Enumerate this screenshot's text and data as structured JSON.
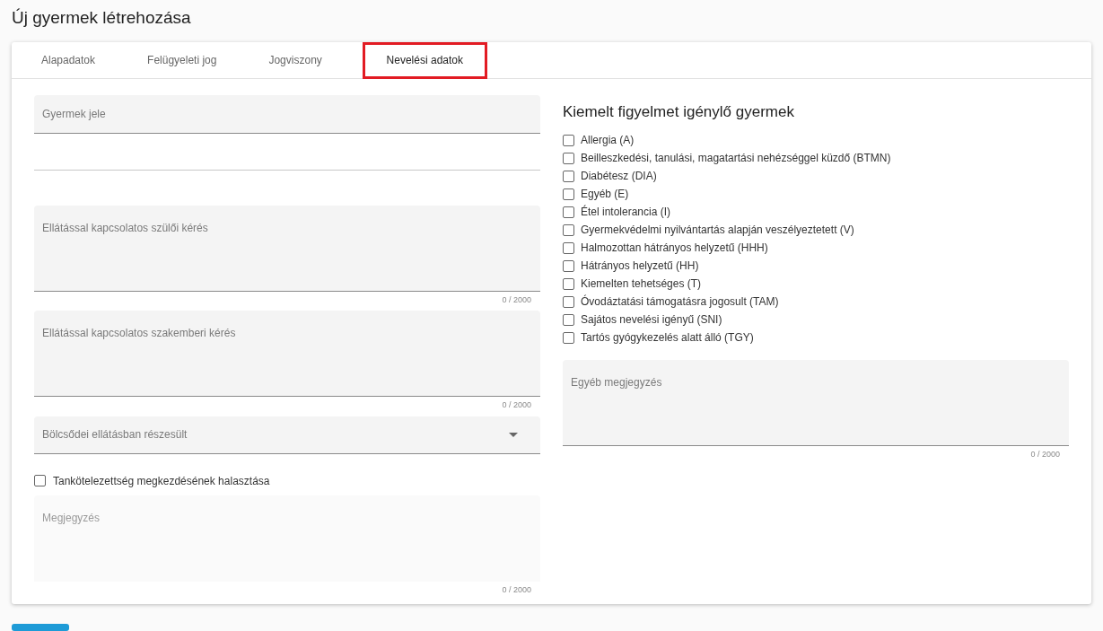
{
  "page": {
    "title": "Új gyermek létrehozása"
  },
  "tabs": [
    {
      "label": "Alapadatok",
      "selected": false
    },
    {
      "label": "Felügyeleti jog",
      "selected": false
    },
    {
      "label": "Jogviszony",
      "selected": false
    },
    {
      "label": "Nevelési adatok",
      "selected": true
    }
  ],
  "left_fields": [
    {
      "kind": "text",
      "label": "Gyermek jele"
    },
    {
      "kind": "line"
    },
    {
      "kind": "textarea",
      "label": "Ellátással kapcsolatos szülői kérés",
      "counter": "0 / 2000",
      "disabled": false
    },
    {
      "kind": "textarea",
      "label": "Ellátással kapcsolatos szakemberi kérés",
      "counter": "0 / 2000",
      "disabled": false
    },
    {
      "kind": "select",
      "label": "Bölcsődei ellátásban részesült"
    },
    {
      "kind": "checkbox",
      "label": "Tankötelezettség megkezdésének halasztása",
      "checked": false
    },
    {
      "kind": "textarea",
      "label": "Megjegyzés",
      "counter": "0 / 2000",
      "disabled": true
    }
  ],
  "special_needs": {
    "title": "Kiemelt figyelmet igénylő gyermek",
    "options": [
      {
        "label": "Allergia (A)",
        "checked": false
      },
      {
        "label": "Beilleszkedési, tanulási, magatartási nehézséggel küzdő (BTMN)",
        "checked": false
      },
      {
        "label": "Diabétesz (DIA)",
        "checked": false
      },
      {
        "label": "Egyéb (E)",
        "checked": false
      },
      {
        "label": "Étel intolerancia (I)",
        "checked": false
      },
      {
        "label": "Gyermekvédelmi nyilvántartás alapján veszélyeztetett (V)",
        "checked": false
      },
      {
        "label": "Halmozottan hátrányos helyzetű (HHH)",
        "checked": false
      },
      {
        "label": "Hátrányos helyzetű (HH)",
        "checked": false
      },
      {
        "label": "Kiemelten tehetséges (T)",
        "checked": false
      },
      {
        "label": "Óvodáztatási támogatásra jogosult (TAM)",
        "checked": false
      },
      {
        "label": "Sajátos nevelési igényű (SNI)",
        "checked": false
      },
      {
        "label": "Tartós gyógykezelés alatt álló (TGY)",
        "checked": false
      }
    ],
    "note": {
      "label": "Egyéb megjegyzés",
      "counter": "0 / 2000",
      "disabled": false
    }
  }
}
